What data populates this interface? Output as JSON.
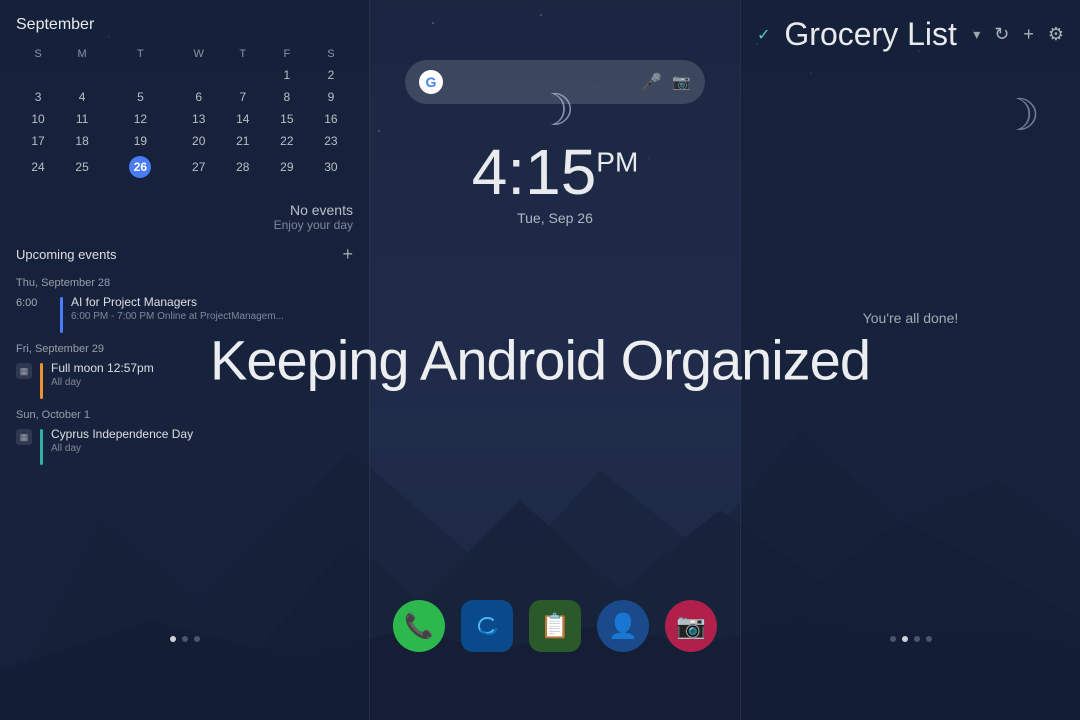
{
  "app": {
    "title": "Keeping Android Organized"
  },
  "left_panel": {
    "calendar": {
      "month": "September",
      "days_header": [
        "S",
        "M",
        "T",
        "W",
        "T",
        "F",
        "S"
      ],
      "weeks": [
        [
          "",
          "",
          "",
          "",
          "",
          "1",
          "2"
        ],
        [
          "3",
          "4",
          "5",
          "6",
          "7",
          "8",
          "9"
        ],
        [
          "10",
          "11",
          "12",
          "13",
          "14",
          "15",
          "16"
        ],
        [
          "17",
          "18",
          "19",
          "20",
          "21",
          "22",
          "23"
        ],
        [
          "24",
          "25",
          "26",
          "27",
          "28",
          "29",
          "30"
        ]
      ],
      "today": "26"
    },
    "no_events": "No events",
    "enjoy": "Enjoy your day",
    "upcoming_label": "Upcoming events",
    "add_label": "+",
    "events": [
      {
        "date_header": "Thu, September 28",
        "time": "6:00",
        "title": "AI for Project Managers",
        "sub": "6:00 PM - 7:00 PM Online at ProjectManagem...",
        "bar_color": "blue"
      },
      {
        "date_header": "Fri, September 29",
        "icon": "calendar",
        "title": "Full moon 12:57pm",
        "sub": "All day",
        "bar_color": "orange"
      },
      {
        "date_header": "Sun, October 1",
        "icon": "calendar",
        "title": "Cyprus Independence Day",
        "sub": "All day",
        "bar_color": "teal"
      }
    ]
  },
  "center_panel": {
    "clock": {
      "time": "4:15",
      "period": "PM",
      "date": "Tue, Sep 26"
    },
    "search": {
      "mic_symbol": "🎤",
      "camera_symbol": "📷"
    },
    "dock_apps": [
      {
        "name": "phone",
        "bg": "#2db84d",
        "symbol": "📞"
      },
      {
        "name": "edge",
        "bg": "#0078d4",
        "symbol": "🌐"
      },
      {
        "name": "notes",
        "bg": "#3a7a3a",
        "symbol": "📋"
      },
      {
        "name": "contacts",
        "bg": "#1a6ab0",
        "symbol": "👤"
      },
      {
        "name": "camera",
        "bg": "#c0305a",
        "symbol": "📷"
      }
    ],
    "nav": {
      "back": "‹",
      "home": "○",
      "recent": "|||"
    }
  },
  "right_panel": {
    "header": {
      "check_symbol": "✓",
      "title": "Grocery List",
      "chevron": "▾",
      "refresh_symbol": "↻",
      "plus_symbol": "+",
      "gear_symbol": "⚙"
    },
    "status": "You're all done!"
  }
}
